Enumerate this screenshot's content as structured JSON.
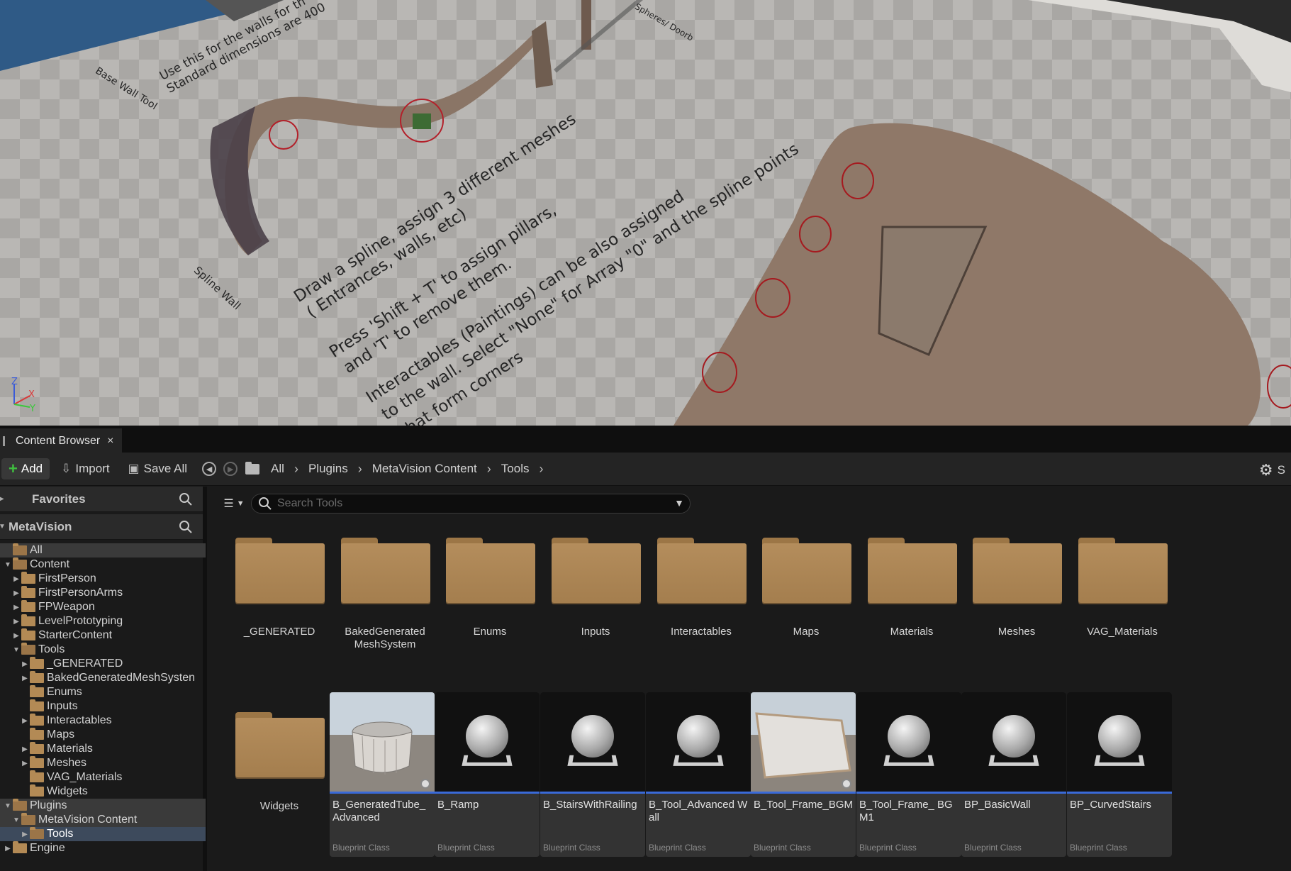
{
  "viewport": {
    "texts": [
      {
        "id": "t1",
        "text": "Use this for the walls for th"
      },
      {
        "id": "t2",
        "text": "Standard dimensions are 400"
      },
      {
        "id": "t3",
        "text": "Base Wall Tool"
      },
      {
        "id": "t4",
        "text": "Spheres/ Doorb"
      },
      {
        "id": "t5",
        "text": "Draw a spline, assign 3 different meshes"
      },
      {
        "id": "t6",
        "text": "( Entrances, walls, etc)"
      },
      {
        "id": "t7",
        "text": "Press  'Shift + T'  to assign pillars,"
      },
      {
        "id": "t8",
        "text": "and  'T' to remove them."
      },
      {
        "id": "t9",
        "text": "Interactables (Paintings) can be also assigned"
      },
      {
        "id": "t10",
        "text": "to the wall. Select \"None\" for Array \"0\" and the spline points"
      },
      {
        "id": "t11",
        "text": "that form corners"
      },
      {
        "id": "t12",
        "text": "Spline Wall"
      }
    ],
    "axis": {
      "z": "Z",
      "x": "X",
      "y": "Y"
    }
  },
  "content_browser": {
    "tab_title": "Content Browser",
    "tab_close": "×",
    "toolbar": {
      "add_label": "Add",
      "import_label": "Import",
      "save_all_label": "Save All",
      "breadcrumbs": [
        "All",
        "Plugins",
        "MetaVision Content",
        "Tools"
      ],
      "settings_label": "S"
    },
    "favorites_label": "Favorites",
    "project_label": "MetaVision",
    "tree": [
      {
        "label": "All",
        "depth": 0,
        "exp": "",
        "open": true,
        "state": "hl"
      },
      {
        "label": "Content",
        "depth": 0,
        "exp": "▼",
        "open": true,
        "state": ""
      },
      {
        "label": "FirstPerson",
        "depth": 1,
        "exp": "▶",
        "open": false,
        "state": ""
      },
      {
        "label": "FirstPersonArms",
        "depth": 1,
        "exp": "▶",
        "open": false,
        "state": ""
      },
      {
        "label": "FPWeapon",
        "depth": 1,
        "exp": "▶",
        "open": false,
        "state": ""
      },
      {
        "label": "LevelPrototyping",
        "depth": 1,
        "exp": "▶",
        "open": false,
        "state": ""
      },
      {
        "label": "StarterContent",
        "depth": 1,
        "exp": "▶",
        "open": false,
        "state": ""
      },
      {
        "label": "Tools",
        "depth": 1,
        "exp": "▼",
        "open": true,
        "state": ""
      },
      {
        "label": "_GENERATED",
        "depth": 2,
        "exp": "▶",
        "open": false,
        "state": ""
      },
      {
        "label": "BakedGeneratedMeshSysten",
        "depth": 2,
        "exp": "▶",
        "open": false,
        "state": ""
      },
      {
        "label": "Enums",
        "depth": 2,
        "exp": "",
        "open": false,
        "state": ""
      },
      {
        "label": "Inputs",
        "depth": 2,
        "exp": "",
        "open": false,
        "state": ""
      },
      {
        "label": "Interactables",
        "depth": 2,
        "exp": "▶",
        "open": false,
        "state": ""
      },
      {
        "label": "Maps",
        "depth": 2,
        "exp": "",
        "open": false,
        "state": ""
      },
      {
        "label": "Materials",
        "depth": 2,
        "exp": "▶",
        "open": false,
        "state": ""
      },
      {
        "label": "Meshes",
        "depth": 2,
        "exp": "▶",
        "open": false,
        "state": ""
      },
      {
        "label": "VAG_Materials",
        "depth": 2,
        "exp": "",
        "open": false,
        "state": ""
      },
      {
        "label": "Widgets",
        "depth": 2,
        "exp": "",
        "open": false,
        "state": ""
      },
      {
        "label": "Plugins",
        "depth": 0,
        "exp": "▼",
        "open": true,
        "state": "hl"
      },
      {
        "label": "MetaVision Content",
        "depth": 1,
        "exp": "▼",
        "open": true,
        "state": "hl"
      },
      {
        "label": "Tools",
        "depth": 2,
        "exp": "▶",
        "open": true,
        "state": "sel"
      },
      {
        "label": "Engine",
        "depth": 0,
        "exp": "▶",
        "open": false,
        "state": ""
      }
    ],
    "search": {
      "placeholder": "Search Tools",
      "value": ""
    },
    "folders": [
      "_GENERATED",
      "BakedGenerated MeshSystem",
      "Enums",
      "Inputs",
      "Interactables",
      "Maps",
      "Materials",
      "Meshes",
      "VAG_Materials",
      "Widgets"
    ],
    "assets": [
      {
        "name": "B_GeneratedTube_ Advanced",
        "type": "Blueprint Class",
        "thumb": "tube-photo"
      },
      {
        "name": "B_Ramp",
        "type": "Blueprint Class",
        "thumb": "sphere"
      },
      {
        "name": "B_StairsWithRailing",
        "type": "Blueprint Class",
        "thumb": "sphere"
      },
      {
        "name": "B_Tool_Advanced Wall",
        "type": "Blueprint Class",
        "thumb": "sphere"
      },
      {
        "name": "B_Tool_Frame_BGM",
        "type": "Blueprint Class",
        "thumb": "frame-photo"
      },
      {
        "name": "B_Tool_Frame_ BGM1",
        "type": "Blueprint Class",
        "thumb": "sphere"
      },
      {
        "name": "BP_BasicWall",
        "type": "Blueprint Class",
        "thumb": "sphere"
      },
      {
        "name": "BP_CurvedStairs",
        "type": "Blueprint Class",
        "thumb": "sphere"
      }
    ]
  }
}
